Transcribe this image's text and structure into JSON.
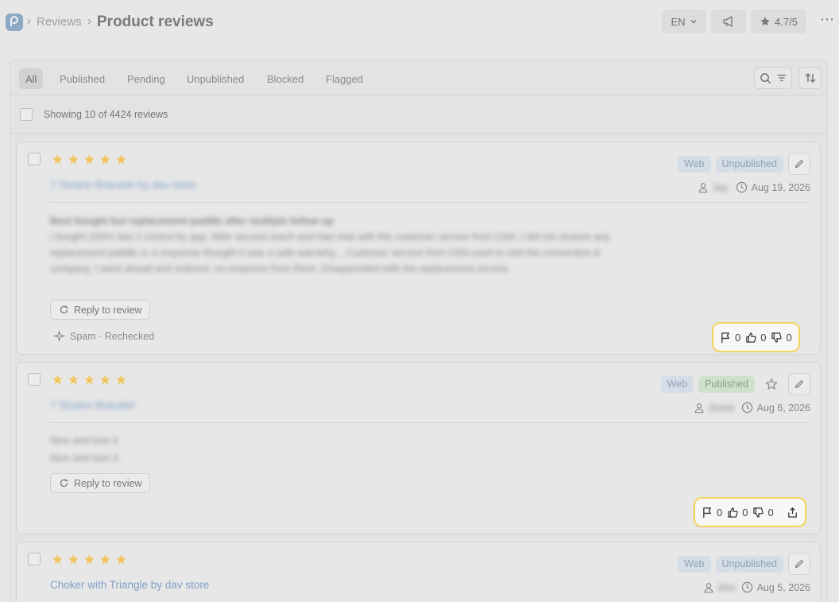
{
  "header": {
    "breadcrumb_parent": "Reviews",
    "title": "Product reviews",
    "language": "EN",
    "rating": "4.7/5"
  },
  "tabs": [
    {
      "label": "All",
      "active": true
    },
    {
      "label": "Published"
    },
    {
      "label": "Pending"
    },
    {
      "label": "Unpublished"
    },
    {
      "label": "Blocked"
    },
    {
      "label": "Flagged"
    }
  ],
  "summary": "Showing 10 of 4424 reviews",
  "colors": {
    "star": "#f0c660",
    "tag_web": "#8ea3b8",
    "tag_published": "#86a682",
    "vote_highlight": "#f2d35c",
    "product_link": "#7ea0c6"
  },
  "reviews": [
    {
      "rating_stars": 5,
      "product": "7 Strains Bracelet by dav store",
      "channel": "Web",
      "status": "Unpublished",
      "author": "Jay",
      "date": "Aug 19, 2026",
      "title": "Best bought but replacement paddle after multiple follow up",
      "body": "I bought 200% fast 2 control by app. After second reach and had chat with the customer service from USA. I did not receive any replacement paddle or a response thought it was a safe warranty... Customer service from USA used to visit the connection & company. I went ahead and ordered. no response from them. Disappointed with the replacement service.",
      "reply_label": "Reply to review",
      "spam_label": "Spam · Rechecked",
      "flags": "0",
      "likes": "0",
      "dislikes": "0"
    },
    {
      "rating_stars": 5,
      "product": "7 Strains Bracelet",
      "channel": "Web",
      "status": "Published",
      "author": "Jesse",
      "date": "Aug 6, 2026",
      "line1": "Nice and love it",
      "line2": "Nice and love it",
      "reply_label": "Reply to review",
      "flags": "0",
      "likes": "0",
      "dislikes": "0"
    },
    {
      "rating_stars": 5,
      "product": "Choker with Triangle by dav store",
      "channel": "Web",
      "status": "Unpublished",
      "author": "Ann",
      "date": "Aug 5, 2026"
    }
  ],
  "icons": [
    "logo-icon",
    "chevron-down-icon",
    "megaphone-icon",
    "star-icon",
    "more-icon",
    "search-icon",
    "filter-icon",
    "sort-icon",
    "pencil-icon",
    "user-icon",
    "clock-icon",
    "refresh-icon",
    "sparkle-icon",
    "flag-icon",
    "thumbs-up-icon",
    "thumbs-down-icon",
    "share-icon",
    "star-outline-icon"
  ]
}
